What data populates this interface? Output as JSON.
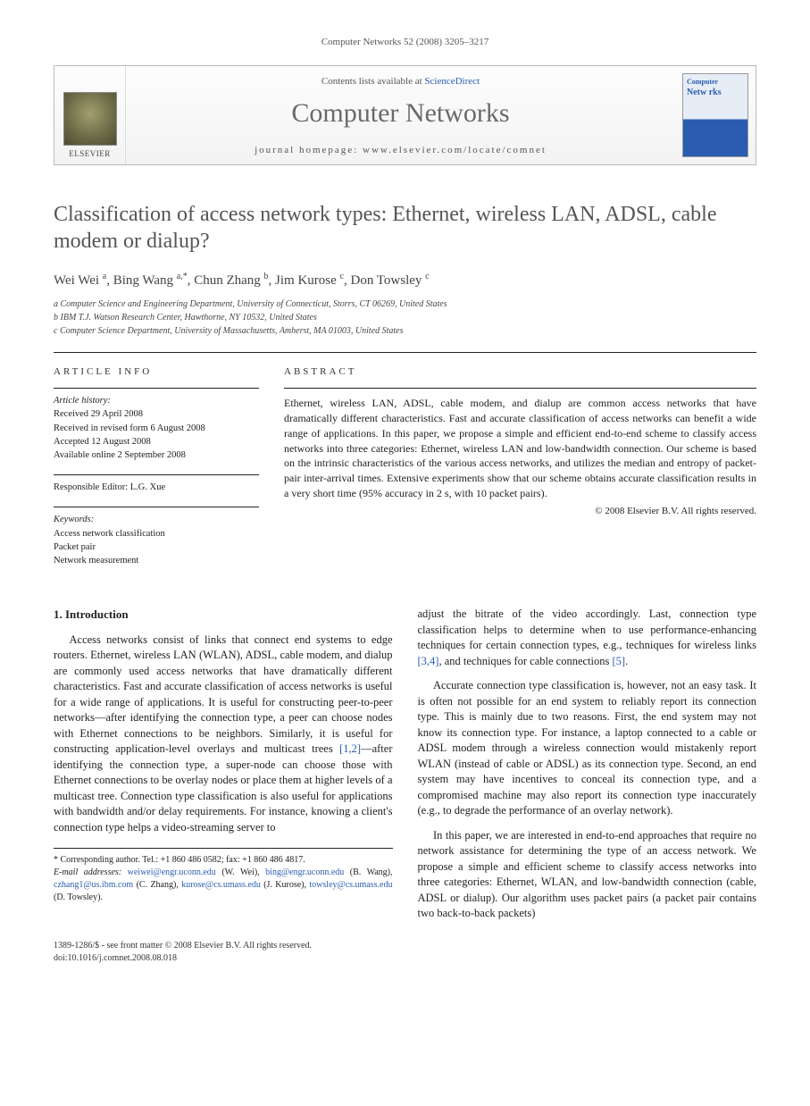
{
  "running_head": "Computer Networks 52 (2008) 3205–3217",
  "masthead": {
    "publisher_name": "ELSEVIER",
    "contents_prefix": "Contents lists available at ",
    "contents_link": "ScienceDirect",
    "journal_name": "Computer Networks",
    "homepage_label": "journal homepage: www.elsevier.com/locate/comnet",
    "cover_top": "Computer",
    "cover_net": "Netw rks"
  },
  "title": "Classification of access network types: Ethernet, wireless LAN, ADSL, cable modem or dialup?",
  "authors_html": "Wei Wei <sup>a</sup>, Bing Wang <sup>a,*</sup>, Chun Zhang <sup>b</sup>, Jim Kurose <sup>c</sup>, Don Towsley <sup>c</sup>",
  "affiliations": {
    "a": "a Computer Science and Engineering Department, University of Connecticut, Storrs, CT 06269, United States",
    "b": "b IBM T.J. Watson Research Center, Hawthorne, NY 10532, United States",
    "c": "c Computer Science Department, University of Massachusetts, Amherst, MA 01003, United States"
  },
  "article_info": {
    "section_label": "ARTICLE INFO",
    "history_label": "Article history:",
    "received": "Received 29 April 2008",
    "revised": "Received in revised form 6 August 2008",
    "accepted": "Accepted 12 August 2008",
    "online": "Available online 2 September 2008",
    "editor_line": "Responsible Editor: L.G. Xue",
    "keywords_label": "Keywords:",
    "keywords": [
      "Access network classification",
      "Packet pair",
      "Network measurement"
    ]
  },
  "abstract": {
    "section_label": "ABSTRACT",
    "text": "Ethernet, wireless LAN, ADSL, cable modem, and dialup are common access networks that have dramatically different characteristics. Fast and accurate classification of access networks can benefit a wide range of applications. In this paper, we propose a simple and efficient end-to-end scheme to classify access networks into three categories: Ethernet, wireless LAN and low-bandwidth connection. Our scheme is based on the intrinsic characteristics of the various access networks, and utilizes the median and entropy of packet-pair inter-arrival times. Extensive experiments show that our scheme obtains accurate classification results in a very short time (95% accuracy in 2 s, with 10 packet pairs).",
    "copyright": "© 2008 Elsevier B.V. All rights reserved."
  },
  "body": {
    "h_intro": "1. Introduction",
    "p1": "Access networks consist of links that connect end systems to edge routers. Ethernet, wireless LAN (WLAN), ADSL, cable modem, and dialup are commonly used access networks that have dramatically different characteristics. Fast and accurate classification of access networks is useful for a wide range of applications. It is useful for constructing peer-to-peer networks—after identifying the connection type, a peer can choose nodes with Ethernet connections to be neighbors. Similarly, it is useful for constructing application-level overlays and multicast trees ",
    "ref12": "[1,2]",
    "p1b": "—after identifying the connection type, a super-node can choose those with Ethernet connections to be overlay nodes or place them at higher levels of a multicast tree. Connection type classification is also useful for applications with bandwidth and/or delay requirements. For instance, knowing a client's connection type helps a video-streaming server to",
    "p2a": "adjust the bitrate of the video accordingly. Last, connection type classification helps to determine when to use performance-enhancing techniques for certain connection types, e.g., techniques for wireless links ",
    "ref34": "[3,4]",
    "p2b": ", and techniques for cable connections ",
    "ref5": "[5]",
    "p2c": ".",
    "p3": "Accurate connection type classification is, however, not an easy task. It is often not possible for an end system to reliably report its connection type. This is mainly due to two reasons. First, the end system may not know its connection type. For instance, a laptop connected to a cable or ADSL modem through a wireless connection would mistakenly report WLAN (instead of cable or ADSL) as its connection type. Second, an end system may have incentives to conceal its connection type, and a compromised machine may also report its connection type inaccurately (e.g., to degrade the performance of an overlay network).",
    "p4": "In this paper, we are interested in end-to-end approaches that require no network assistance for determining the type of an access network. We propose a simple and efficient scheme to classify access networks into three categories: Ethernet, WLAN, and low-bandwidth connection (cable, ADSL or dialup). Our algorithm uses packet pairs (a packet pair contains two back-to-back packets)"
  },
  "footnote": {
    "corresponding": "* Corresponding author. Tel.: +1 860 486 0582; fax: +1 860 486 4817.",
    "email_label": "E-mail addresses:",
    "emails": "weiwei@engr.uconn.edu (W. Wei), bing@engr.uconn.edu (B. Wang), czhang1@us.ibm.com (C. Zhang), kurose@cs.umass.edu (J. Kurose), towsley@cs.umass.edu (D. Towsley)."
  },
  "footer": {
    "line1": "1389-1286/$ - see front matter © 2008 Elsevier B.V. All rights reserved.",
    "doi": "doi:10.1016/j.comnet.2008.08.018"
  }
}
